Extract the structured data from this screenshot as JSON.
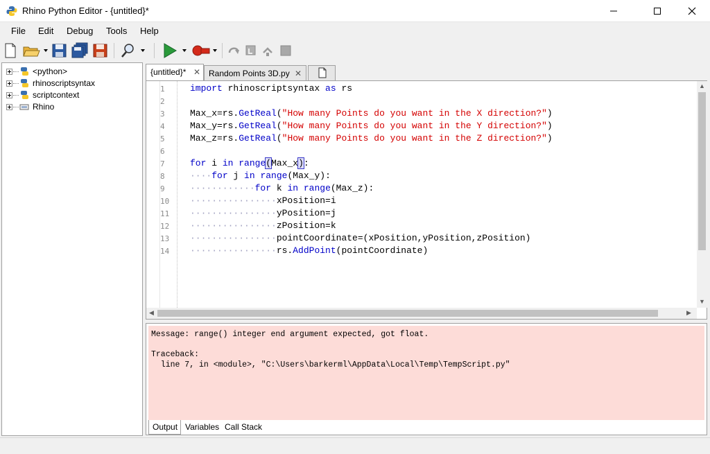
{
  "window": {
    "title": "Rhino Python Editor - {untitled}*"
  },
  "menu": [
    "File",
    "Edit",
    "Debug",
    "Tools",
    "Help"
  ],
  "toolbar": {
    "icons": [
      "new-file-icon",
      "open-folder-icon",
      "save-icon",
      "save-all-icon",
      "save-as-icon",
      "find-icon",
      "run-icon",
      "record-icon",
      "step-over-icon",
      "step-into-icon",
      "step-out-icon",
      "stop-icon"
    ]
  },
  "tree": {
    "items": [
      {
        "label": "<python>",
        "icon": "python-icon"
      },
      {
        "label": "rhinoscriptsyntax",
        "icon": "python-icon"
      },
      {
        "label": "scriptcontext",
        "icon": "python-icon"
      },
      {
        "label": "Rhino",
        "icon": "assembly-icon"
      }
    ]
  },
  "tabs": [
    {
      "label": "{untitled}*",
      "close": "✕"
    },
    {
      "label": "Random Points 3D.py",
      "close": "✕"
    }
  ],
  "editor": {
    "line_numbers": [
      "1",
      "2",
      "3",
      "4",
      "5",
      "6",
      "7",
      "8",
      "9",
      "10",
      "11",
      "12",
      "13",
      "14"
    ]
  },
  "output": {
    "message": "Message: range() integer end argument expected, got float.",
    "traceback_title": "Traceback:",
    "traceback_line": "  line 7, in <module>, \"C:\\Users\\barkerml\\AppData\\Local\\Temp\\TempScript.py\"",
    "tabs": [
      "Output",
      "Variables",
      "Call Stack"
    ]
  },
  "colors": {
    "keyword": "#0000c8",
    "string": "#d40000",
    "error_background": "#fddcd8"
  }
}
